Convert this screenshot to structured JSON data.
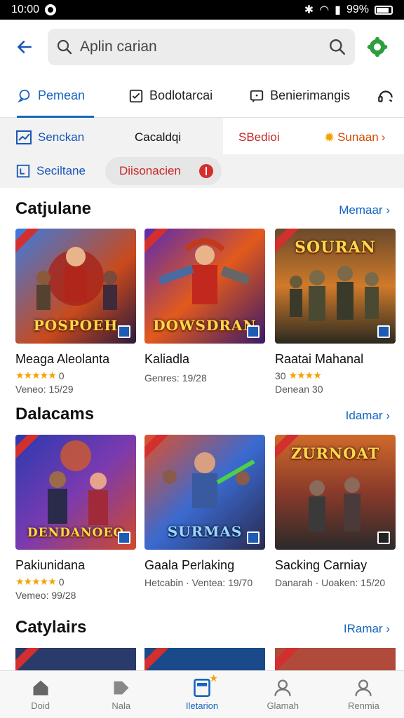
{
  "status": {
    "time": "10:00",
    "battery": "99%"
  },
  "header": {
    "search_placeholder": "Aplin carian"
  },
  "tabs": [
    {
      "label": "Pemean",
      "active": true
    },
    {
      "label": "Bodlotarcai",
      "active": false
    },
    {
      "label": "Benierimangis",
      "active": false
    }
  ],
  "filters": {
    "row1": [
      {
        "label": "Senckan",
        "style": "blue"
      },
      {
        "label": "Cacaldqi",
        "style": "dark"
      },
      {
        "label": "SBedioi",
        "style": "red"
      },
      {
        "label": "Sunaan",
        "style": "orange"
      }
    ],
    "row2": [
      {
        "label": "Seciltane",
        "style": "blue"
      },
      {
        "label": "Diisonacien",
        "style": "red"
      }
    ]
  },
  "sections": [
    {
      "title": "Catjulane",
      "more": "Memaar",
      "cards": [
        {
          "name": "Meaga Aleolanta",
          "rating": "0",
          "meta": "Veneo: 15/29",
          "art_title": "POSPOEH"
        },
        {
          "name": "Kaliadla",
          "rating": "",
          "meta": "Genres: 19/28",
          "art_title": "DOWSDRAN"
        },
        {
          "name": "Raatai Mahanal",
          "rating": "30",
          "meta": "Denean 30",
          "art_title": "SOURAN"
        }
      ]
    },
    {
      "title": "Dalacams",
      "more": "Idamar",
      "cards": [
        {
          "name": "Pakiunidana",
          "rating": "0",
          "meta": "Vemeo: 99/28",
          "art_title": "DENDANOEO"
        },
        {
          "name": "Gaala Perlaking",
          "rating": "",
          "meta": "Hetcabin · Ventea: 19/70",
          "art_title": "SURMAS"
        },
        {
          "name": "Sacking Carniay",
          "rating": "",
          "meta": "Danarah · Uoaken: 15/20",
          "art_title": "ZURNOAT"
        }
      ]
    },
    {
      "title": "Catylairs",
      "more": "IRamar"
    }
  ],
  "bottom_nav": [
    {
      "label": "Doid",
      "icon": "home-icon"
    },
    {
      "label": "Nala",
      "icon": "tag-icon"
    },
    {
      "label": "Iletarion",
      "icon": "library-icon",
      "active": true
    },
    {
      "label": "Glamah",
      "icon": "person-icon"
    },
    {
      "label": "Renmia",
      "icon": "profile-icon"
    }
  ],
  "colors": {
    "accent": "#1565c0",
    "alert": "#d32f2f",
    "star": "#f2a300"
  }
}
